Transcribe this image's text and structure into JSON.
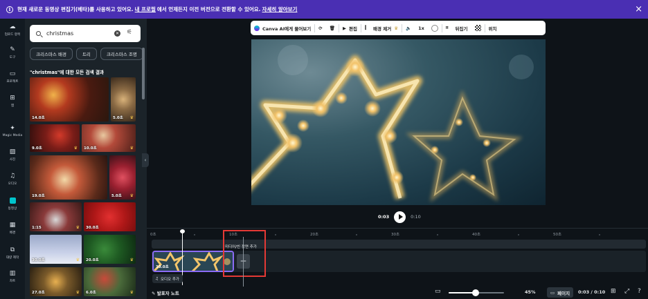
{
  "banner": {
    "text_before": "현재 새로운 동영상 편집기(베타)를 사용하고 있어요.",
    "link_profile": "내 프로필",
    "text_middle": "에서 언제든지 이전 버전으로 전환할 수 있어요.",
    "link_learn": "자세히 알아보기",
    "close_icon": "×"
  },
  "rail": {
    "items": [
      {
        "label": "업로드 항목",
        "icon": "☁"
      },
      {
        "label": "도구",
        "icon": "✎"
      },
      {
        "label": "프로젝트",
        "icon": "▭"
      },
      {
        "label": "앱",
        "icon": "⊞"
      },
      {
        "label": "Magic Media",
        "icon": "✦"
      },
      {
        "label": "사진",
        "icon": "▨"
      },
      {
        "label": "오디오",
        "icon": "♫"
      },
      {
        "label": "동영상",
        "icon": ""
      },
      {
        "label": "배경",
        "icon": "▦"
      },
      {
        "label": "대량 제작",
        "icon": "⧉"
      },
      {
        "label": "차트",
        "icon": "▥"
      }
    ],
    "active": "동영상"
  },
  "panel": {
    "search_value": "christmas",
    "chips": [
      "크리스마스 배경",
      "트리",
      "크리스마스 조명"
    ],
    "results_title": "\"christmas\"에 대한 모든 검색 결과",
    "thumbs": [
      {
        "dur": "14.0초"
      },
      {
        "dur": "5.0초"
      },
      {
        "dur": "9.0초"
      },
      {
        "dur": "10.0초"
      },
      {
        "dur": "19.0초"
      },
      {
        "dur": "5.0초"
      },
      {
        "dur": "1:15"
      },
      {
        "dur": "30.0초"
      },
      {
        "dur": "30.0초"
      },
      {
        "dur": "20.0초"
      },
      {
        "dur": "27.0초"
      },
      {
        "dur": "6.0초"
      }
    ]
  },
  "toolbar": {
    "ask_canva": "Canva AI에게 물어보기",
    "edit": "편집",
    "bg_remove": "배경 제거",
    "speed": "1x",
    "flip": "뒤집기",
    "position": "위치"
  },
  "player": {
    "current": "0:03",
    "total": "0:10"
  },
  "timeline": {
    "ticks": [
      "0초",
      "10초",
      "20초",
      "30초",
      "40초",
      "50초"
    ],
    "clip_duration": "10.0초",
    "add_scene_tip": "미디어/빈 장면 추가",
    "add_audio": "오디오 추가"
  },
  "bottombar": {
    "notes": "발표자 노트",
    "zoom": "45%",
    "pages": "페이지",
    "time": "0:03 / 0:10"
  }
}
